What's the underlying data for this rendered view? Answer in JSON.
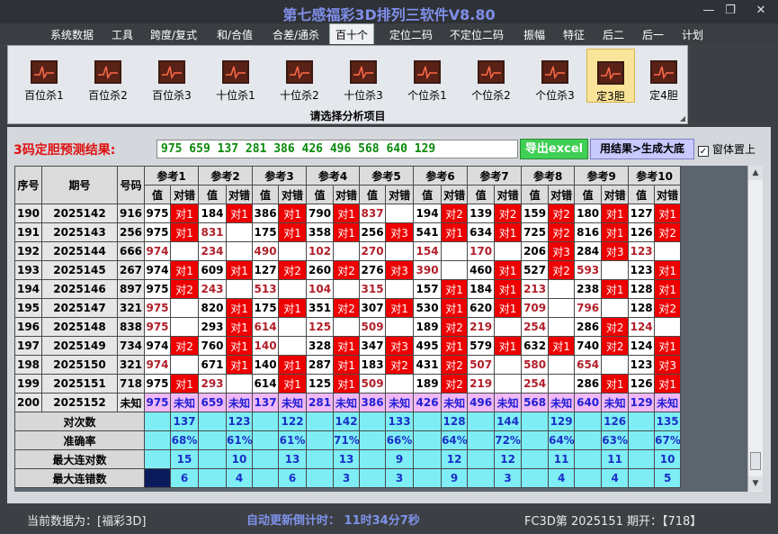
{
  "window": {
    "title": "第七感福彩3D排列三软件V8.80",
    "controls": [
      "—",
      "❐",
      "✕"
    ]
  },
  "menu": [
    {
      "label": "系统数据",
      "active": false
    },
    {
      "label": "工具",
      "active": false
    },
    {
      "label": "跨度/复式",
      "active": false
    },
    {
      "label": "和/合值",
      "active": false
    },
    {
      "label": "合差/通杀",
      "active": false
    },
    {
      "label": "百十个",
      "active": true
    },
    {
      "label": "定位二码",
      "active": false
    },
    {
      "label": "不定位二码",
      "active": false
    },
    {
      "label": "振幅",
      "active": false
    },
    {
      "label": "特征",
      "active": false
    },
    {
      "label": "后二",
      "active": false
    },
    {
      "label": "后一",
      "active": false
    },
    {
      "label": "计划",
      "active": false
    }
  ],
  "toolbar": {
    "caption": "请选择分析项目",
    "tools": [
      {
        "label": "百位杀1",
        "icon": "chart-icon",
        "selected": false
      },
      {
        "label": "百位杀2",
        "icon": "chart-icon",
        "selected": false
      },
      {
        "label": "百位杀3",
        "icon": "chart-icon",
        "selected": false
      },
      {
        "label": "十位杀1",
        "icon": "chart-icon",
        "selected": false
      },
      {
        "label": "十位杀2",
        "icon": "chart-icon",
        "selected": false
      },
      {
        "label": "十位杀3",
        "icon": "chart-icon",
        "selected": false
      },
      {
        "label": "个位杀1",
        "icon": "chart-icon",
        "selected": false
      },
      {
        "label": "个位杀2",
        "icon": "chart-icon",
        "selected": false
      },
      {
        "label": "个位杀3",
        "icon": "chart-icon",
        "selected": false
      },
      {
        "label": "定3胆",
        "icon": "chart-icon",
        "selected": true
      },
      {
        "label": "定4胆",
        "icon": "chart-icon",
        "selected": false
      }
    ]
  },
  "prediction": {
    "label": "3码定胆预测结果:",
    "value": "975 659 137 281 386 426 496 568 640 129",
    "export_label": "导出excel",
    "generate_label": "用结果>生成大底",
    "topmost_label": "窗体置上",
    "topmost_checked": true
  },
  "grid": {
    "headers": {
      "seq": "序号",
      "period": "期号",
      "number": "号码",
      "value": "值",
      "result": "对错"
    },
    "refs": [
      "参考1",
      "参考2",
      "参考3",
      "参考4",
      "参考5",
      "参考6",
      "参考7",
      "参考8",
      "参考9",
      "参考10"
    ],
    "rows": [
      {
        "seq": "190",
        "period": "2025142",
        "number": "916",
        "cells": [
          [
            "975",
            "对1"
          ],
          [
            "184",
            "对1"
          ],
          [
            "386",
            "对1"
          ],
          [
            "790",
            "对1"
          ],
          [
            "837",
            ""
          ],
          [
            "194",
            "对2"
          ],
          [
            "139",
            "对2"
          ],
          [
            "159",
            "对2"
          ],
          [
            "180",
            "对1"
          ],
          [
            "127",
            "对1"
          ]
        ]
      },
      {
        "seq": "191",
        "period": "2025143",
        "number": "256",
        "cells": [
          [
            "975",
            "对1"
          ],
          [
            "831",
            ""
          ],
          [
            "175",
            "对1"
          ],
          [
            "358",
            "对1"
          ],
          [
            "256",
            "对3"
          ],
          [
            "541",
            "对1"
          ],
          [
            "634",
            "对1"
          ],
          [
            "725",
            "对2"
          ],
          [
            "816",
            "对1"
          ],
          [
            "126",
            "对2"
          ]
        ]
      },
      {
        "seq": "192",
        "period": "2025144",
        "number": "666",
        "cells": [
          [
            "974",
            ""
          ],
          [
            "234",
            ""
          ],
          [
            "490",
            ""
          ],
          [
            "102",
            ""
          ],
          [
            "270",
            ""
          ],
          [
            "154",
            ""
          ],
          [
            "170",
            ""
          ],
          [
            "206",
            "对3"
          ],
          [
            "284",
            "对3"
          ],
          [
            "123",
            ""
          ]
        ]
      },
      {
        "seq": "193",
        "period": "2025145",
        "number": "267",
        "cells": [
          [
            "974",
            "对1"
          ],
          [
            "609",
            "对1"
          ],
          [
            "127",
            "对2"
          ],
          [
            "260",
            "对2"
          ],
          [
            "276",
            "对3"
          ],
          [
            "390",
            ""
          ],
          [
            "460",
            "对1"
          ],
          [
            "527",
            "对2"
          ],
          [
            "593",
            ""
          ],
          [
            "123",
            "对1"
          ]
        ]
      },
      {
        "seq": "194",
        "period": "2025146",
        "number": "897",
        "cells": [
          [
            "975",
            "对2"
          ],
          [
            "243",
            ""
          ],
          [
            "513",
            ""
          ],
          [
            "104",
            ""
          ],
          [
            "315",
            ""
          ],
          [
            "157",
            "对1"
          ],
          [
            "184",
            "对1"
          ],
          [
            "213",
            ""
          ],
          [
            "238",
            "对1"
          ],
          [
            "128",
            "对1"
          ]
        ]
      },
      {
        "seq": "195",
        "period": "2025147",
        "number": "321",
        "cells": [
          [
            "975",
            ""
          ],
          [
            "820",
            "对1"
          ],
          [
            "175",
            "对1"
          ],
          [
            "351",
            "对2"
          ],
          [
            "307",
            "对1"
          ],
          [
            "530",
            "对1"
          ],
          [
            "620",
            "对1"
          ],
          [
            "709",
            ""
          ],
          [
            "796",
            ""
          ],
          [
            "128",
            "对2"
          ]
        ]
      },
      {
        "seq": "196",
        "period": "2025148",
        "number": "838",
        "cells": [
          [
            "975",
            ""
          ],
          [
            "293",
            "对1"
          ],
          [
            "614",
            ""
          ],
          [
            "125",
            ""
          ],
          [
            "509",
            ""
          ],
          [
            "189",
            "对2"
          ],
          [
            "219",
            ""
          ],
          [
            "254",
            ""
          ],
          [
            "286",
            "对2"
          ],
          [
            "124",
            ""
          ]
        ]
      },
      {
        "seq": "197",
        "period": "2025149",
        "number": "734",
        "cells": [
          [
            "974",
            "对2"
          ],
          [
            "760",
            "对1"
          ],
          [
            "140",
            ""
          ],
          [
            "328",
            "对1"
          ],
          [
            "347",
            "对3"
          ],
          [
            "495",
            "对1"
          ],
          [
            "579",
            "对1"
          ],
          [
            "632",
            "对1"
          ],
          [
            "740",
            "对2"
          ],
          [
            "124",
            "对1"
          ]
        ]
      },
      {
        "seq": "198",
        "period": "2025150",
        "number": "321",
        "cells": [
          [
            "974",
            ""
          ],
          [
            "671",
            "对1"
          ],
          [
            "140",
            "对1"
          ],
          [
            "287",
            "对1"
          ],
          [
            "183",
            "对2"
          ],
          [
            "431",
            "对2"
          ],
          [
            "507",
            ""
          ],
          [
            "580",
            ""
          ],
          [
            "654",
            ""
          ],
          [
            "123",
            "对3"
          ]
        ]
      },
      {
        "seq": "199",
        "period": "2025151",
        "number": "718",
        "cells": [
          [
            "975",
            "对1"
          ],
          [
            "293",
            ""
          ],
          [
            "614",
            "对1"
          ],
          [
            "125",
            "对1"
          ],
          [
            "509",
            ""
          ],
          [
            "189",
            "对2"
          ],
          [
            "219",
            ""
          ],
          [
            "254",
            ""
          ],
          [
            "286",
            "对1"
          ],
          [
            "126",
            "对1"
          ]
        ]
      }
    ],
    "pending": {
      "seq": "200",
      "period": "2025152",
      "number": "未知",
      "unknown": "未知",
      "values": [
        "975",
        "659",
        "137",
        "281",
        "386",
        "426",
        "496",
        "568",
        "640",
        "129"
      ]
    },
    "stats": [
      {
        "label": "对次数",
        "values": [
          "137",
          "123",
          "122",
          "142",
          "133",
          "128",
          "144",
          "129",
          "126",
          "135"
        ]
      },
      {
        "label": "准确率",
        "values": [
          "68%",
          "61%",
          "61%",
          "71%",
          "66%",
          "64%",
          "72%",
          "64%",
          "63%",
          "67%"
        ]
      },
      {
        "label": "最大连对数",
        "values": [
          "15",
          "10",
          "13",
          "13",
          "9",
          "12",
          "12",
          "11",
          "11",
          "10"
        ]
      },
      {
        "label": "最大连错数",
        "values": [
          "6",
          "4",
          "6",
          "3",
          "3",
          "9",
          "3",
          "4",
          "4",
          "5"
        ]
      }
    ]
  },
  "status": {
    "left": "当前数据为：[福彩3D]",
    "middle": "自动更新倒计时：  11时34分7秒",
    "right": "FC3D第 2025151 期开：【718】"
  }
}
